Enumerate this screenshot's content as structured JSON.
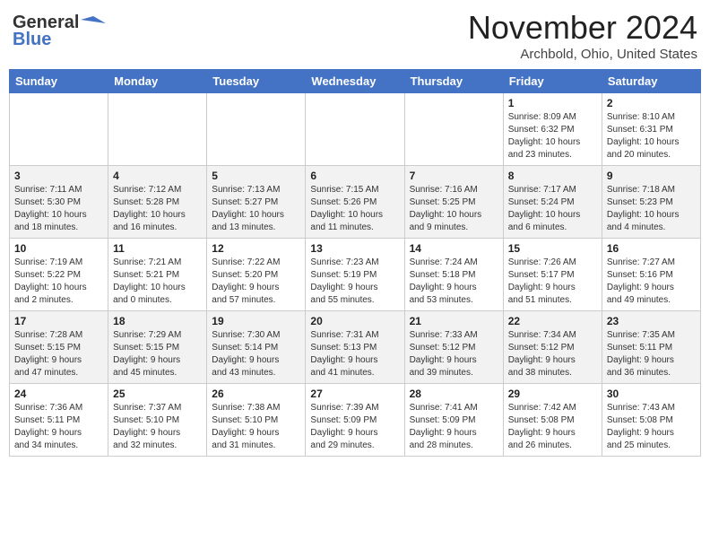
{
  "logo": {
    "line1": "General",
    "line2": "Blue"
  },
  "title": "November 2024",
  "location": "Archbold, Ohio, United States",
  "days_of_week": [
    "Sunday",
    "Monday",
    "Tuesday",
    "Wednesday",
    "Thursday",
    "Friday",
    "Saturday"
  ],
  "weeks": [
    [
      {
        "day": "",
        "info": ""
      },
      {
        "day": "",
        "info": ""
      },
      {
        "day": "",
        "info": ""
      },
      {
        "day": "",
        "info": ""
      },
      {
        "day": "",
        "info": ""
      },
      {
        "day": "1",
        "info": "Sunrise: 8:09 AM\nSunset: 6:32 PM\nDaylight: 10 hours\nand 23 minutes."
      },
      {
        "day": "2",
        "info": "Sunrise: 8:10 AM\nSunset: 6:31 PM\nDaylight: 10 hours\nand 20 minutes."
      }
    ],
    [
      {
        "day": "3",
        "info": "Sunrise: 7:11 AM\nSunset: 5:30 PM\nDaylight: 10 hours\nand 18 minutes."
      },
      {
        "day": "4",
        "info": "Sunrise: 7:12 AM\nSunset: 5:28 PM\nDaylight: 10 hours\nand 16 minutes."
      },
      {
        "day": "5",
        "info": "Sunrise: 7:13 AM\nSunset: 5:27 PM\nDaylight: 10 hours\nand 13 minutes."
      },
      {
        "day": "6",
        "info": "Sunrise: 7:15 AM\nSunset: 5:26 PM\nDaylight: 10 hours\nand 11 minutes."
      },
      {
        "day": "7",
        "info": "Sunrise: 7:16 AM\nSunset: 5:25 PM\nDaylight: 10 hours\nand 9 minutes."
      },
      {
        "day": "8",
        "info": "Sunrise: 7:17 AM\nSunset: 5:24 PM\nDaylight: 10 hours\nand 6 minutes."
      },
      {
        "day": "9",
        "info": "Sunrise: 7:18 AM\nSunset: 5:23 PM\nDaylight: 10 hours\nand 4 minutes."
      }
    ],
    [
      {
        "day": "10",
        "info": "Sunrise: 7:19 AM\nSunset: 5:22 PM\nDaylight: 10 hours\nand 2 minutes."
      },
      {
        "day": "11",
        "info": "Sunrise: 7:21 AM\nSunset: 5:21 PM\nDaylight: 10 hours\nand 0 minutes."
      },
      {
        "day": "12",
        "info": "Sunrise: 7:22 AM\nSunset: 5:20 PM\nDaylight: 9 hours\nand 57 minutes."
      },
      {
        "day": "13",
        "info": "Sunrise: 7:23 AM\nSunset: 5:19 PM\nDaylight: 9 hours\nand 55 minutes."
      },
      {
        "day": "14",
        "info": "Sunrise: 7:24 AM\nSunset: 5:18 PM\nDaylight: 9 hours\nand 53 minutes."
      },
      {
        "day": "15",
        "info": "Sunrise: 7:26 AM\nSunset: 5:17 PM\nDaylight: 9 hours\nand 51 minutes."
      },
      {
        "day": "16",
        "info": "Sunrise: 7:27 AM\nSunset: 5:16 PM\nDaylight: 9 hours\nand 49 minutes."
      }
    ],
    [
      {
        "day": "17",
        "info": "Sunrise: 7:28 AM\nSunset: 5:15 PM\nDaylight: 9 hours\nand 47 minutes."
      },
      {
        "day": "18",
        "info": "Sunrise: 7:29 AM\nSunset: 5:15 PM\nDaylight: 9 hours\nand 45 minutes."
      },
      {
        "day": "19",
        "info": "Sunrise: 7:30 AM\nSunset: 5:14 PM\nDaylight: 9 hours\nand 43 minutes."
      },
      {
        "day": "20",
        "info": "Sunrise: 7:31 AM\nSunset: 5:13 PM\nDaylight: 9 hours\nand 41 minutes."
      },
      {
        "day": "21",
        "info": "Sunrise: 7:33 AM\nSunset: 5:12 PM\nDaylight: 9 hours\nand 39 minutes."
      },
      {
        "day": "22",
        "info": "Sunrise: 7:34 AM\nSunset: 5:12 PM\nDaylight: 9 hours\nand 38 minutes."
      },
      {
        "day": "23",
        "info": "Sunrise: 7:35 AM\nSunset: 5:11 PM\nDaylight: 9 hours\nand 36 minutes."
      }
    ],
    [
      {
        "day": "24",
        "info": "Sunrise: 7:36 AM\nSunset: 5:11 PM\nDaylight: 9 hours\nand 34 minutes."
      },
      {
        "day": "25",
        "info": "Sunrise: 7:37 AM\nSunset: 5:10 PM\nDaylight: 9 hours\nand 32 minutes."
      },
      {
        "day": "26",
        "info": "Sunrise: 7:38 AM\nSunset: 5:10 PM\nDaylight: 9 hours\nand 31 minutes."
      },
      {
        "day": "27",
        "info": "Sunrise: 7:39 AM\nSunset: 5:09 PM\nDaylight: 9 hours\nand 29 minutes."
      },
      {
        "day": "28",
        "info": "Sunrise: 7:41 AM\nSunset: 5:09 PM\nDaylight: 9 hours\nand 28 minutes."
      },
      {
        "day": "29",
        "info": "Sunrise: 7:42 AM\nSunset: 5:08 PM\nDaylight: 9 hours\nand 26 minutes."
      },
      {
        "day": "30",
        "info": "Sunrise: 7:43 AM\nSunset: 5:08 PM\nDaylight: 9 hours\nand 25 minutes."
      }
    ]
  ]
}
